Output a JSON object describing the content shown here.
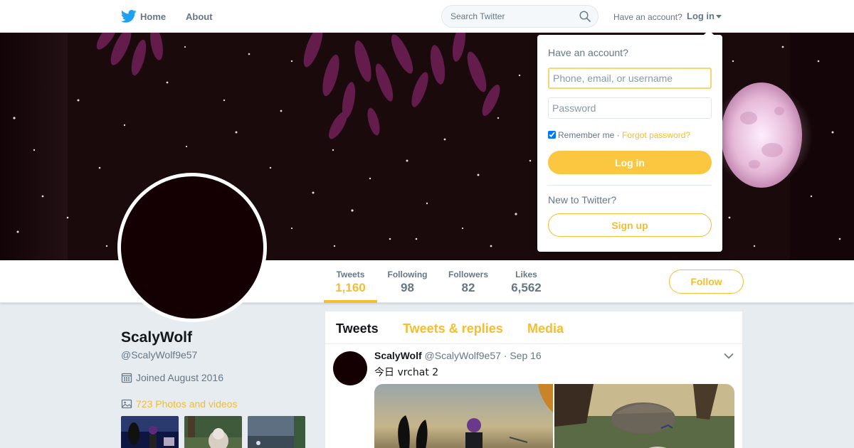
{
  "nav": {
    "home_label": "Home",
    "about_label": "About",
    "search_placeholder": "Search Twitter",
    "have_account": "Have an account?",
    "login_label": "Log in"
  },
  "profile": {
    "name": "ScalyWolf",
    "handle": "@ScalyWolf9e57",
    "joined": "Joined August 2016",
    "photos_link": "723 Photos and videos"
  },
  "stats": [
    {
      "label": "Tweets",
      "value": "1,160",
      "active": true
    },
    {
      "label": "Following",
      "value": "98",
      "active": false
    },
    {
      "label": "Followers",
      "value": "82",
      "active": false
    },
    {
      "label": "Likes",
      "value": "6,562",
      "active": false
    }
  ],
  "follow_label": "Follow",
  "timeline": {
    "tabs": [
      "Tweets",
      "Tweets & replies",
      "Media"
    ],
    "tweet": {
      "name": "ScalyWolf",
      "handle": "@ScalyWolf9e57",
      "dot": "·",
      "date": "Sep 16",
      "text": "今日 vrchat 2"
    }
  },
  "login_dropdown": {
    "title": "Have an account?",
    "username_placeholder": "Phone, email, or username",
    "password_placeholder": "Password",
    "remember_label": "Remember me",
    "separator": "·",
    "forgot_label": "Forgot password?",
    "login_button": "Log in",
    "new_label": "New to Twitter?",
    "signup_button": "Sign up"
  },
  "colors": {
    "accent": "#f5bd2f",
    "twitter_blue": "#1da1f2",
    "banner_bg": "#1a0a0c",
    "avatar_bg": "#140003"
  },
  "icons": {
    "logo": "twitter-bird-icon",
    "search": "search-icon",
    "calendar": "calendar-icon",
    "photos": "image-icon",
    "tweet_menu": "chevron-down-icon"
  }
}
